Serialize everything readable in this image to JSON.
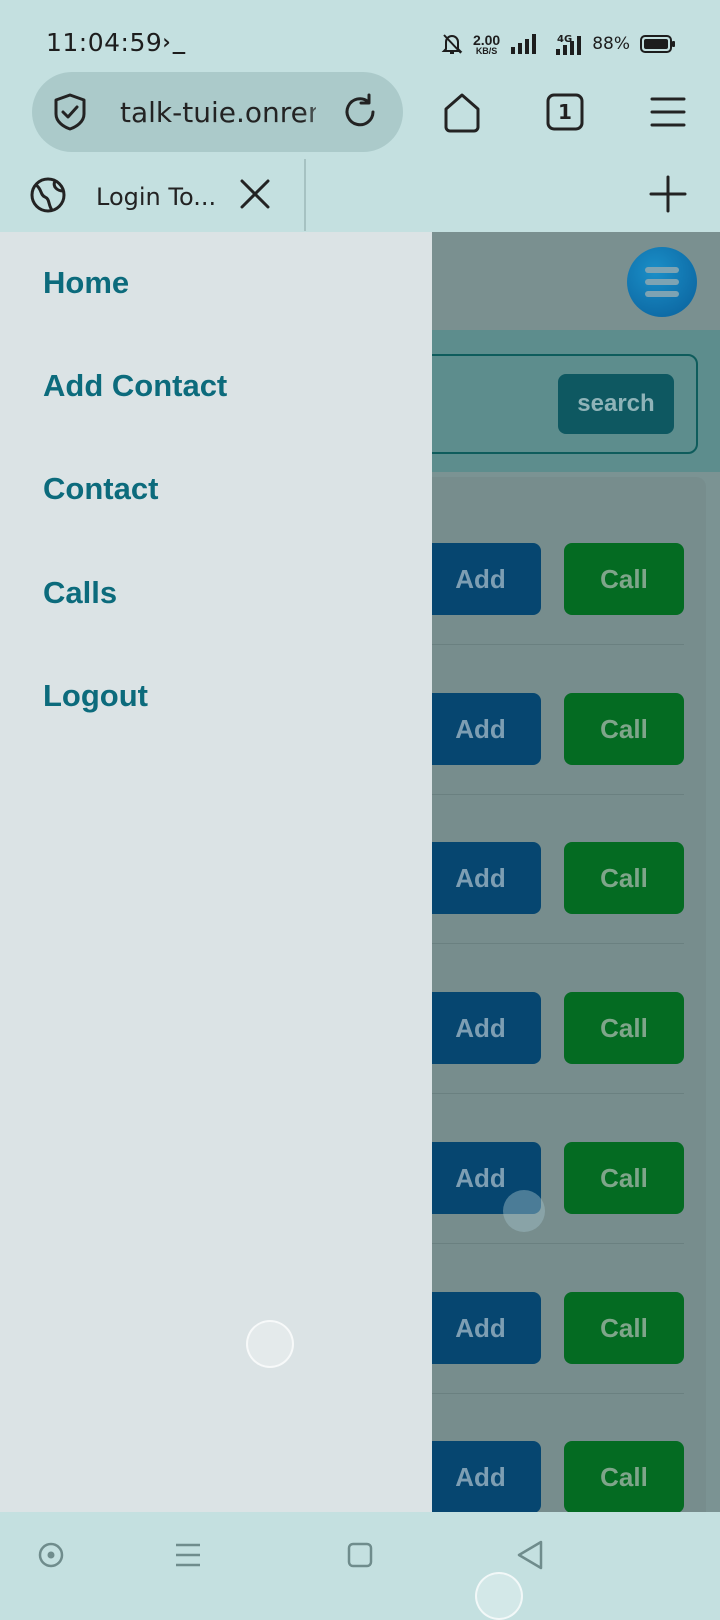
{
  "status_bar": {
    "time": "11:04:59",
    "terminal_glyph": "›_",
    "net_speed_value": "2.00",
    "net_speed_unit": "KB/S",
    "network_type": "4G",
    "battery_percent": "88%"
  },
  "browser": {
    "url": "talk-tuie.onrender.com",
    "tab_count": "1",
    "tab_title": "Login To..."
  },
  "drawer": {
    "items": [
      {
        "label": "Home"
      },
      {
        "label": "Add Contact"
      },
      {
        "label": "Contact"
      },
      {
        "label": "Calls"
      },
      {
        "label": "Logout"
      }
    ]
  },
  "search": {
    "button_label": "search"
  },
  "contacts": {
    "rows": [
      {
        "add_label": "Add",
        "call_label": "Call"
      },
      {
        "add_label": "Add",
        "call_label": "Call"
      },
      {
        "add_label": "Add",
        "call_label": "Call"
      },
      {
        "add_label": "Add",
        "call_label": "Call"
      },
      {
        "add_label": "Add",
        "call_label": "Call"
      },
      {
        "add_label": "Add",
        "call_label": "Call"
      },
      {
        "add_label": "Add",
        "call_label": "Call"
      }
    ]
  },
  "colors": {
    "browser_chrome": "#c4e0e0",
    "drawer_bg": "#dbe3e5",
    "drawer_link": "#0c6b7c",
    "add_button": "#064670",
    "call_button": "#046b22",
    "search_button": "#0e5861"
  },
  "icons": {
    "shield": "shield-check-icon",
    "reload": "reload-icon",
    "home": "home-icon",
    "tabs": "tab-count-icon",
    "menu": "hamburger-menu-icon",
    "globe": "globe-icon",
    "close": "close-icon",
    "new_tab": "plus-icon",
    "app_menu": "menu-fab-icon"
  }
}
